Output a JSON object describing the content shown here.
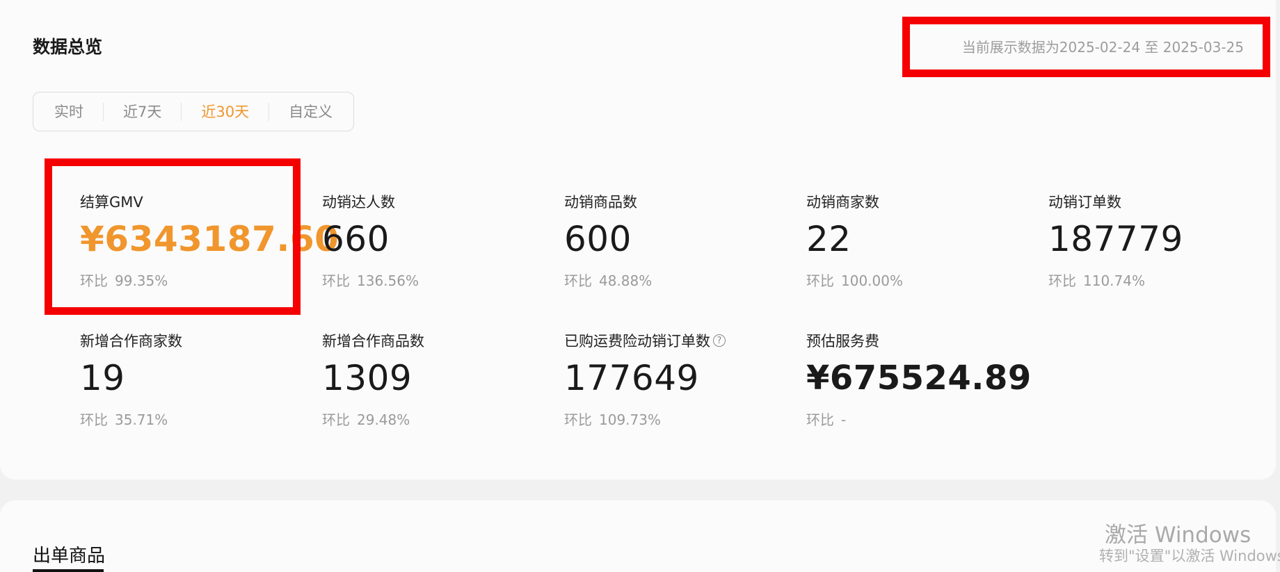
{
  "overview": {
    "title": "数据总览",
    "range_note": "当前展示数据为2025-02-24 至 2025-03-25",
    "tabs": [
      {
        "label": "实时",
        "active": false
      },
      {
        "label": "近7天",
        "active": false
      },
      {
        "label": "近30天",
        "active": true
      },
      {
        "label": "自定义",
        "active": false
      }
    ],
    "compare_prefix": "环比",
    "metrics": [
      {
        "label": "结算GMV",
        "value": "¥6343187.60",
        "change": "99.35%"
      },
      {
        "label": "动销达人数",
        "value": "660",
        "change": "136.56%"
      },
      {
        "label": "动销商品数",
        "value": "600",
        "change": "48.88%"
      },
      {
        "label": "动销商家数",
        "value": "22",
        "change": "100.00%"
      },
      {
        "label": "动销订单数",
        "value": "187779",
        "change": "110.74%"
      },
      {
        "label": "新增合作商家数",
        "value": "19",
        "change": "35.71%"
      },
      {
        "label": "新增合作商品数",
        "value": "1309",
        "change": "29.48%"
      },
      {
        "label": "已购运费险动销订单数",
        "value": "177649",
        "change": "109.73%"
      },
      {
        "label": "预估服务费",
        "value": "¥675524.89",
        "change": "-"
      }
    ],
    "help_icon_glyph": "?"
  },
  "products": {
    "title": "出单商品"
  },
  "watermark": {
    "line1": "激活 Windows",
    "line2": "转到\"设置\"以激活 Windows。"
  },
  "colors": {
    "accent": "#f0962d",
    "highlight": "#f50000"
  }
}
